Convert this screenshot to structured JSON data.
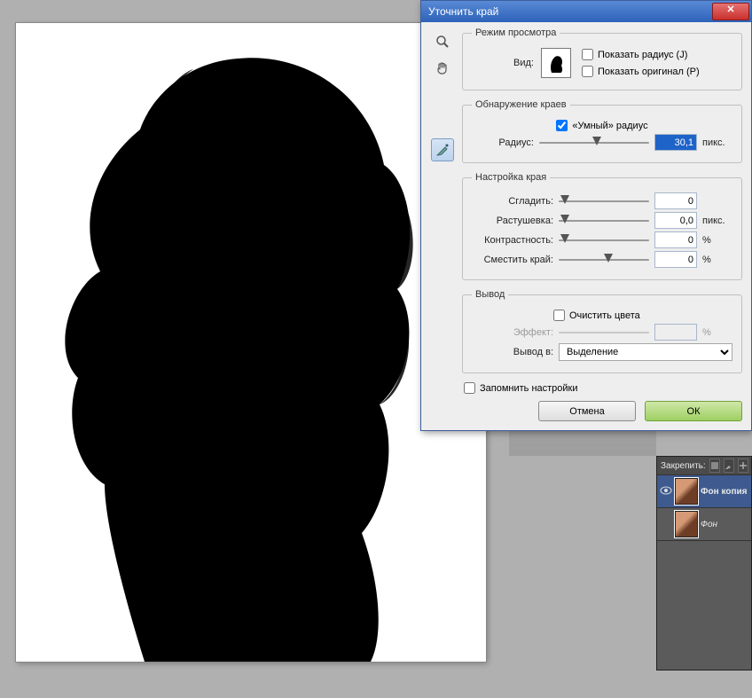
{
  "dialog": {
    "title": "Уточнить край",
    "sections": {
      "view": {
        "legend": "Режим просмотра",
        "view_label": "Вид:",
        "show_radius_label": "Показать радиус (J)",
        "show_radius_checked": false,
        "show_original_label": "Показать оригинал (P)",
        "show_original_checked": false
      },
      "edge": {
        "legend": "Обнаружение краев",
        "smart_radius_label": "«Умный» радиус",
        "smart_radius_checked": true,
        "radius_label": "Радиус:",
        "radius_value": "30,1",
        "radius_unit": "пикс.",
        "radius_pos_pct": 48
      },
      "adjust": {
        "legend": "Настройка края",
        "smooth_label": "Сгладить:",
        "smooth_value": "0",
        "feather_label": "Растушевка:",
        "feather_value": "0,0",
        "feather_unit": "пикс.",
        "contrast_label": "Контрастность:",
        "contrast_value": "0",
        "contrast_unit": "%",
        "shift_label": "Сместить край:",
        "shift_value": "0",
        "shift_unit": "%",
        "smooth_pos_pct": 2,
        "feather_pos_pct": 2,
        "contrast_pos_pct": 2,
        "shift_pos_pct": 50
      },
      "output": {
        "legend": "Вывод",
        "decontaminate_label": "Очистить цвета",
        "decontaminate_checked": false,
        "amount_label": "Эффект:",
        "amount_value": "",
        "amount_unit": "%",
        "output_to_label": "Вывод в:",
        "output_selected": "Выделение"
      }
    },
    "remember_label": "Запомнить настройки",
    "remember_checked": false,
    "buttons": {
      "cancel": "Отмена",
      "ok": "ОК"
    }
  },
  "layers": {
    "header_label": "Закрепить:",
    "items": [
      {
        "name": "Фон копия",
        "visible": true,
        "selected": true
      },
      {
        "name": "Фон",
        "visible": false,
        "selected": false
      }
    ]
  }
}
